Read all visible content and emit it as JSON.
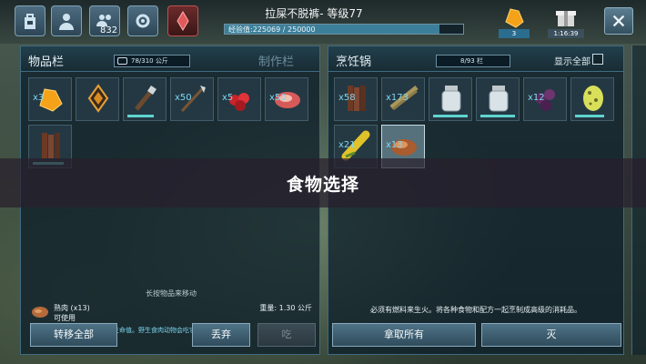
{
  "hud": {
    "player_name": "拉屎不脱裤- 等级77",
    "xp_text": "经验值:225069 / 250000",
    "xp_fraction": 0.9,
    "notification_count": "832",
    "amber_count": "3",
    "timer": "1:16:39",
    "icons": [
      "backpack-icon",
      "character-icon",
      "tribe-icon",
      "engram-icon",
      "obelisk-icon",
      "amber-icon",
      "gift-icon",
      "close-icon"
    ]
  },
  "inventory": {
    "title": "物品栏",
    "craft_tab": "制作栏",
    "weight": "78/310 公斤",
    "items": [
      {
        "name": "amber",
        "qty": "x3",
        "icon": "amber-icon"
      },
      {
        "name": "cryopod",
        "qty": "",
        "icon": "cryo-icon"
      },
      {
        "name": "torch",
        "qty": "",
        "icon": "torch-icon",
        "durability": 0.75
      },
      {
        "name": "spear",
        "qty": "x50",
        "icon": "spear-icon"
      },
      {
        "name": "red-berries",
        "qty": "x5",
        "icon": "berry-icon"
      },
      {
        "name": "raw-meat",
        "qty": "x50",
        "icon": "meat-icon"
      },
      {
        "name": "wood",
        "qty": "",
        "icon": "wood-icon",
        "durability": 0.9
      }
    ],
    "hint": "长按物品来移动",
    "selected_name": "熟肉 (x13)",
    "selected_state": "可使用",
    "selected_weight": "重量: 1.30 公斤",
    "selected_desc": "减缓你的饥饿感，消化时增加生命值。野生食肉动物会吃它，但更喜爱生肉。",
    "buttons": {
      "transfer_all": "转移全部",
      "drop": "丢弃",
      "eat": "吃"
    }
  },
  "cooking": {
    "title": "烹饪锅",
    "weight": "8/93 栏",
    "show_all": "显示全部",
    "items": [
      {
        "name": "wood",
        "qty": "x58",
        "icon": "wood-icon"
      },
      {
        "name": "fiber",
        "qty": "x173",
        "icon": "fiber-icon"
      },
      {
        "name": "water-jar",
        "qty": "",
        "icon": "jar-icon",
        "durability": 1.0
      },
      {
        "name": "water-jar",
        "qty": "",
        "icon": "jar-icon",
        "durability": 1.0
      },
      {
        "name": "narcoberries",
        "qty": "x12",
        "icon": "narcoberry-icon"
      },
      {
        "name": "egg",
        "qty": "",
        "icon": "egg-icon",
        "durability": 0.85
      },
      {
        "name": "corn",
        "qty": "x21",
        "icon": "corn-icon"
      },
      {
        "name": "cooked-meat",
        "qty": "x13",
        "icon": "cooked-meat-icon"
      }
    ],
    "desc": "必须有燃料来生火。将各种食物和配方一起烹制成高级的消耗品。",
    "buttons": {
      "take_all": "拿取所有",
      "extinguish": "灭"
    }
  },
  "banner": {
    "text": "食物选择"
  },
  "colors": {
    "accent": "#7fd6f2",
    "durability": "#5fd5d0",
    "panel": "#0e202a"
  }
}
